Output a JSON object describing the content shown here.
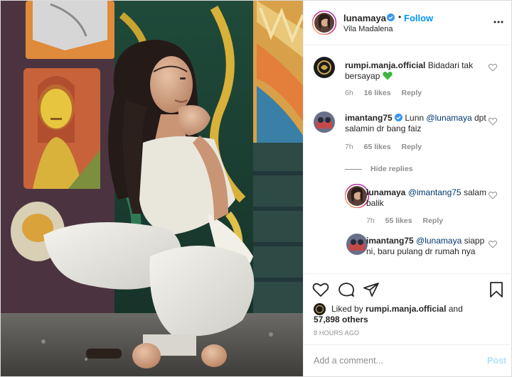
{
  "post": {
    "author": {
      "username": "lunamaya",
      "verified": true,
      "follow_label": "Follow",
      "separator": "•",
      "location": "Vila Madalena"
    },
    "photo": {
      "description_icon": "photo-woman-mural"
    },
    "comments": [
      {
        "username": "rumpi.manja.official",
        "text": "Bidadari tak bersayap",
        "emoji": "green-heart-icon",
        "time": "6h",
        "likes": "16 likes",
        "reply_label": "Reply"
      },
      {
        "username": "imantang75",
        "verified": true,
        "text_pre": "Lunn",
        "mention": "@lunamaya",
        "text_post": "dpt salamin dr bang faiz",
        "time": "7h",
        "likes": "65 likes",
        "reply_label": "Reply",
        "hide_replies_label": "Hide replies",
        "replies": [
          {
            "username": "lunamaya",
            "mention": "@imantang75",
            "text": "salam balik",
            "time": "7h",
            "likes": "55 likes",
            "reply_label": "Reply"
          },
          {
            "username": "imantang75",
            "mention": "@lunamaya",
            "text": "siapp ni, baru pulang dr rumah nya"
          }
        ]
      }
    ],
    "actions": {
      "like_icon": "heart-icon",
      "comment_icon": "comment-icon",
      "share_icon": "paper-plane-icon",
      "save_icon": "bookmark-icon"
    },
    "liked_by": {
      "prefix": "Liked by",
      "username": "rumpi.manja.official",
      "conjunction": "and",
      "others": "57,898 others"
    },
    "time_ago": "8 HOURS AGO",
    "add_comment": {
      "placeholder": "Add a comment...",
      "post_label": "Post"
    }
  }
}
